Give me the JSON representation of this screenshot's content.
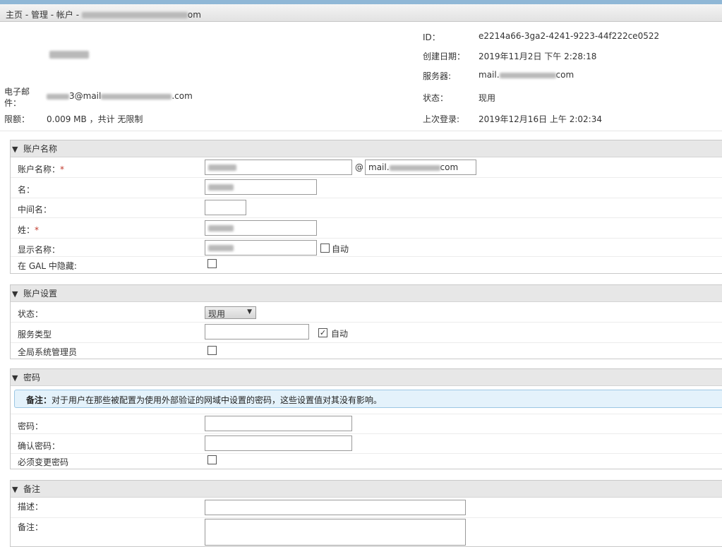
{
  "breadcrumb": {
    "prefix": "主页 - 管理 - 帐户 - ",
    "suffix": "om"
  },
  "header": {
    "email_label": "电子邮件：",
    "email_user_suffix": "3@mail",
    "email_domain_suffix": ".com",
    "quota_label": "限额：",
    "quota_value": "0.009 MB ，共计 无限制",
    "id_label": "ID：",
    "id_value": "e2214a66-3ga2-4241-9223-44f222ce0522",
    "created_label": "创建日期：",
    "created_value": "2019年11月2日 下午 2:28:18",
    "server_label": "服务器:",
    "server_prefix": "mail.",
    "server_suffix": "com",
    "status_label": "状态：",
    "status_value": "现用",
    "last_login_label": "上次登录:",
    "last_login_value": "2019年12月16日 上午 2:02:34"
  },
  "account_name": {
    "title": "账户名称",
    "name_label": "账户名称：",
    "required_mark": "*",
    "at_sign": "@",
    "domain_prefix": "mail.",
    "domain_suffix": "com",
    "first_name_label": "名：",
    "middle_name_label": "中间名：",
    "last_name_label": "姓：",
    "display_name_label": "显示名称：",
    "auto_label": "自动",
    "hide_gal_label": "在 GAL 中隐藏:"
  },
  "account_settings": {
    "title": "账户设置",
    "status_label": "状态：",
    "status_value": "现用",
    "service_type_label": "服务类型",
    "auto_label": "自动",
    "auto_checked": true,
    "global_admin_label": "全局系统管理员"
  },
  "password": {
    "title": "密码",
    "note_bold": "备注：",
    "note_text": "对于用户在那些被配置为使用外部验证的网域中设置的密码，这些设置值对其没有影响。",
    "password_label": "密码：",
    "confirm_label": "确认密码：",
    "must_change_label": "必须变更密码"
  },
  "notes": {
    "title": "备注",
    "description_label": "描述：",
    "notes_label": "备注："
  },
  "icons": {
    "collapse": "triangle-down-icon",
    "dropdown": "chevron-down-icon",
    "check": "checkmark-icon"
  }
}
